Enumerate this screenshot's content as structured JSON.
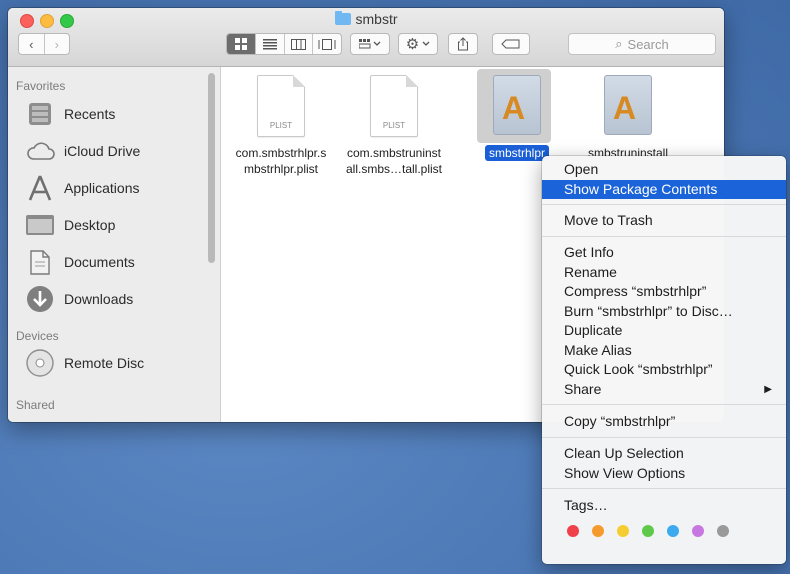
{
  "window": {
    "title": "smbstr"
  },
  "toolbar": {
    "back": "‹",
    "forward": "›",
    "search_placeholder": "Search"
  },
  "sidebar": {
    "favorites_heading": "Favorites",
    "favorites": [
      {
        "label": "Recents",
        "icon": "recents-icon"
      },
      {
        "label": "iCloud Drive",
        "icon": "cloud-icon"
      },
      {
        "label": "Applications",
        "icon": "applications-icon"
      },
      {
        "label": "Desktop",
        "icon": "desktop-icon"
      },
      {
        "label": "Documents",
        "icon": "documents-icon"
      },
      {
        "label": "Downloads",
        "icon": "downloads-icon"
      }
    ],
    "devices_heading": "Devices",
    "devices": [
      {
        "label": "Remote Disc",
        "icon": "disc-icon"
      }
    ],
    "shared_heading": "Shared"
  },
  "files": [
    {
      "kind": "PLIST",
      "line1": "com.smbstrhlpr.s",
      "line2": "mbstrhlpr.plist"
    },
    {
      "kind": "PLIST",
      "line1": "com.smbstruninst",
      "line2": "all.smbs…tall.plist"
    },
    {
      "name": "smbstrhlpr",
      "selected": true
    },
    {
      "name": "smbstruninstall"
    }
  ],
  "context_menu": {
    "open": "Open",
    "show_package_contents": "Show Package Contents",
    "move_to_trash": "Move to Trash",
    "get_info": "Get Info",
    "rename": "Rename",
    "compress": "Compress “smbstrhlpr”",
    "burn": "Burn “smbstrhlpr” to Disc…",
    "duplicate": "Duplicate",
    "make_alias": "Make Alias",
    "quick_look": "Quick Look “smbstrhlpr”",
    "share": "Share",
    "copy": "Copy “smbstrhlpr”",
    "clean_up": "Clean Up Selection",
    "show_view_options": "Show View Options",
    "tags": "Tags…",
    "tag_colors": [
      "#f0404a",
      "#f59b2e",
      "#f5cd33",
      "#5fc94c",
      "#3daaf0",
      "#c778e0",
      "#9a9a9a"
    ]
  }
}
